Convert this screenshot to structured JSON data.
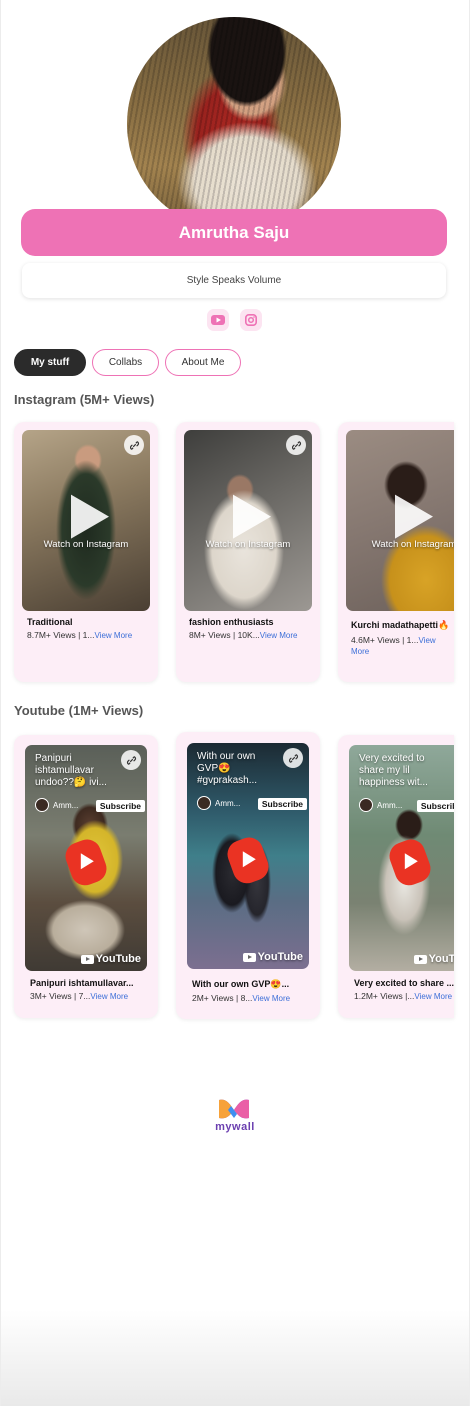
{
  "profile": {
    "name": "Amrutha Saju",
    "bio": "Style Speaks Volume"
  },
  "social_icons": [
    "youtube-icon",
    "instagram-icon"
  ],
  "tabs": [
    {
      "label": "My stuff",
      "active": true
    },
    {
      "label": "Collabs",
      "active": false
    },
    {
      "label": "About Me",
      "active": false
    }
  ],
  "instagram": {
    "title": "Instagram (5M+ Views)",
    "watch_label": "Watch on Instagram",
    "cards": [
      {
        "title": "Traditional",
        "meta": "8.7M+ Views | 1...",
        "view_more": "View More"
      },
      {
        "title": "fashion enthusiasts",
        "meta": "8M+ Views | 10K...",
        "view_more": "View More"
      },
      {
        "title": "Kurchi madathapetti🔥",
        "meta": "4.6M+ Views | 1...",
        "view_more": "View More"
      }
    ]
  },
  "youtube": {
    "title": "Youtube (1M+ Views)",
    "subscribe_label": "Subscribe",
    "youtube_word": "YouTube",
    "cards": [
      {
        "overlay": "Panipuri ishtamullavar undoo??🤔 ivi...",
        "channel": "Amm...",
        "title": "Panipuri ishtamullavar...",
        "meta": "3M+ Views | 7...",
        "view_more": "View More"
      },
      {
        "overlay": "With our own GVP😍 #gvprakash...",
        "channel": "Amm...",
        "title": "With our own GVP😍...",
        "meta": "2M+ Views | 8...",
        "view_more": "View More"
      },
      {
        "overlay": "Very excited to share my lil happiness wit...",
        "channel": "Amm...",
        "title": "Very excited to share ...",
        "meta": "1.2M+ Views |...",
        "view_more": "View More"
      }
    ]
  },
  "footer": {
    "brand": "mywall"
  },
  "colors": {
    "accent": "#ee72b5",
    "card_bg": "#fdeef7",
    "active_tab": "#2b2b2b",
    "link_blue": "#3c6fd8",
    "youtube_red": "#ea3323"
  }
}
